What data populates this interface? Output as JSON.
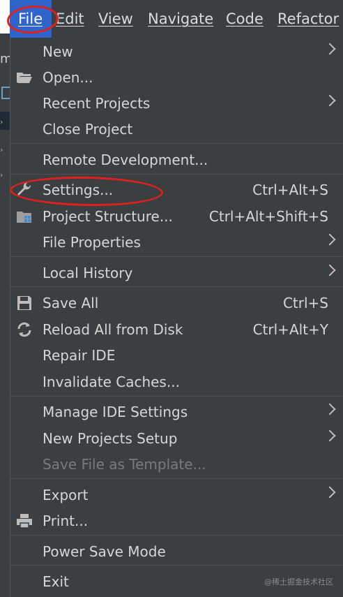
{
  "menubar": {
    "items": [
      {
        "label": "File"
      },
      {
        "label": "Edit"
      },
      {
        "label": "View"
      },
      {
        "label": "Navigate"
      },
      {
        "label": "Code"
      },
      {
        "label": "Refactor"
      }
    ]
  },
  "background": {
    "partial_letter": "m"
  },
  "file_menu": {
    "new": {
      "label": "New",
      "submenu": true
    },
    "open": {
      "label": "Open...",
      "icon": "folder-open-icon"
    },
    "recent_projects": {
      "label": "Recent Projects",
      "submenu": true
    },
    "close_project": {
      "label": "Close Project"
    },
    "remote_development": {
      "label": "Remote Development..."
    },
    "settings": {
      "label": "Settings...",
      "shortcut": "Ctrl+Alt+S",
      "icon": "wrench-icon"
    },
    "project_structure": {
      "label": "Project Structure...",
      "shortcut": "Ctrl+Alt+Shift+S",
      "icon": "project-structure-icon"
    },
    "file_properties": {
      "label": "File Properties",
      "submenu": true
    },
    "local_history": {
      "label": "Local History",
      "submenu": true
    },
    "save_all": {
      "label": "Save All",
      "shortcut": "Ctrl+S",
      "icon": "save-icon"
    },
    "reload_all": {
      "label": "Reload All from Disk",
      "shortcut": "Ctrl+Alt+Y",
      "icon": "reload-icon"
    },
    "repair_ide": {
      "label": "Repair IDE"
    },
    "invalidate_caches": {
      "label": "Invalidate Caches..."
    },
    "manage_ide_settings": {
      "label": "Manage IDE Settings",
      "submenu": true
    },
    "new_projects_setup": {
      "label": "New Projects Setup",
      "submenu": true
    },
    "save_file_as_template": {
      "label": "Save File as Template...",
      "disabled": true
    },
    "export": {
      "label": "Export",
      "submenu": true
    },
    "print": {
      "label": "Print...",
      "icon": "printer-icon"
    },
    "power_save_mode": {
      "label": "Power Save Mode"
    },
    "exit": {
      "label": "Exit"
    }
  },
  "annotation": {
    "color": "#e0201c"
  },
  "watermark": "@稀土掘金技术社区",
  "colors": {
    "menu_bg": "#3c3f41",
    "selected_menu": "#2f65ca",
    "text": "#d6d6d6",
    "disabled_text": "#7a7a7a"
  }
}
